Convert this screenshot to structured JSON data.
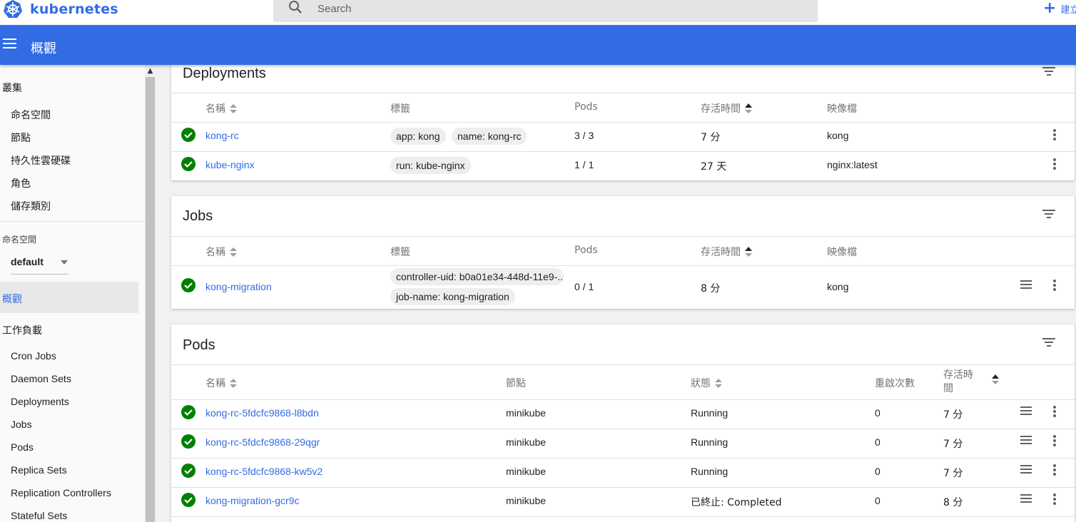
{
  "brand": {
    "name": "kubernetes",
    "color": "#326ce5"
  },
  "search": {
    "placeholder": "Search"
  },
  "create": {
    "label": "建立"
  },
  "toolbar": {
    "title": "概觀"
  },
  "sidebar": {
    "cluster": {
      "title": "叢集",
      "items": [
        "命名空間",
        "節點",
        "持久性雲硬碟",
        "角色",
        "儲存類別"
      ]
    },
    "namespace": {
      "label": "命名空間",
      "selected": "default"
    },
    "overview": "概觀",
    "workloads": {
      "title": "工作負載",
      "items": [
        "Cron Jobs",
        "Daemon Sets",
        "Deployments",
        "Jobs",
        "Pods",
        "Replica Sets",
        "Replication Controllers",
        "Stateful Sets"
      ]
    }
  },
  "deployments": {
    "title": "Deployments",
    "headers": {
      "name": "名稱",
      "labels": "標籤",
      "pods": "Pods",
      "age": "存活時間",
      "images": "映像檔"
    },
    "rows": [
      {
        "name": "kong-rc",
        "labels": [
          "app: kong",
          "name: kong-rc"
        ],
        "pods": "3 / 3",
        "age": "7 分",
        "image": "kong"
      },
      {
        "name": "kube-nginx",
        "labels": [
          "run: kube-nginx"
        ],
        "pods": "1 / 1",
        "age": "27 天",
        "image": "nginx:latest"
      }
    ]
  },
  "jobs": {
    "title": "Jobs",
    "headers": {
      "name": "名稱",
      "labels": "標籤",
      "pods": "Pods",
      "age": "存活時間",
      "images": "映像檔"
    },
    "rows": [
      {
        "name": "kong-migration",
        "labels": [
          "controller-uid: b0a01e34-448d-11e9-...",
          "job-name: kong-migration"
        ],
        "pods": "0 / 1",
        "age": "8 分",
        "image": "kong"
      }
    ]
  },
  "pods": {
    "title": "Pods",
    "headers": {
      "name": "名稱",
      "node": "節點",
      "status": "狀態",
      "restarts": "重啟次數",
      "age": "存活時間"
    },
    "rows": [
      {
        "name": "kong-rc-5fdcfc9868-l8bdn",
        "node": "minikube",
        "status": "Running",
        "restarts": "0",
        "age": "7 分"
      },
      {
        "name": "kong-rc-5fdcfc9868-29qgr",
        "node": "minikube",
        "status": "Running",
        "restarts": "0",
        "age": "7 分"
      },
      {
        "name": "kong-rc-5fdcfc9868-kw5v2",
        "node": "minikube",
        "status": "Running",
        "restarts": "0",
        "age": "7 分"
      },
      {
        "name": "kong-migration-gcr9c",
        "node": "minikube",
        "status": "已終止: Completed",
        "restarts": "0",
        "age": "8 分"
      }
    ]
  },
  "colors": {
    "ok": "#008000",
    "link": "#326ce5",
    "toolbar": "#326ce5"
  }
}
